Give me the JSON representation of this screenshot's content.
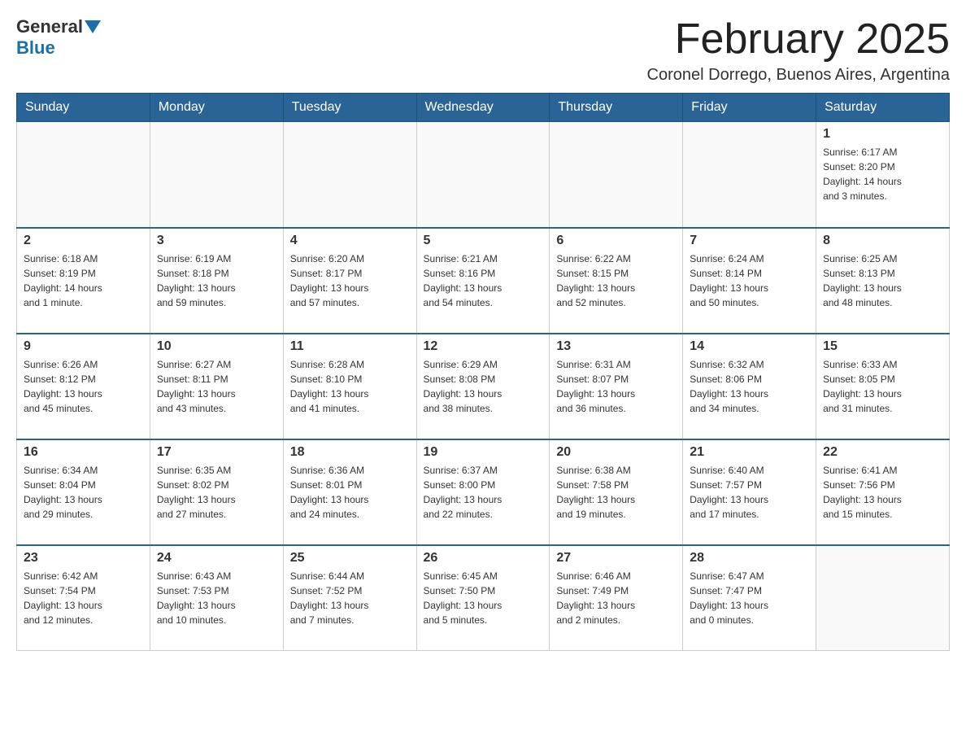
{
  "logo": {
    "general": "General",
    "blue": "Blue"
  },
  "header": {
    "month_title": "February 2025",
    "location": "Coronel Dorrego, Buenos Aires, Argentina"
  },
  "weekdays": [
    "Sunday",
    "Monday",
    "Tuesday",
    "Wednesday",
    "Thursday",
    "Friday",
    "Saturday"
  ],
  "weeks": [
    [
      {
        "day": "",
        "info": ""
      },
      {
        "day": "",
        "info": ""
      },
      {
        "day": "",
        "info": ""
      },
      {
        "day": "",
        "info": ""
      },
      {
        "day": "",
        "info": ""
      },
      {
        "day": "",
        "info": ""
      },
      {
        "day": "1",
        "info": "Sunrise: 6:17 AM\nSunset: 8:20 PM\nDaylight: 14 hours\nand 3 minutes."
      }
    ],
    [
      {
        "day": "2",
        "info": "Sunrise: 6:18 AM\nSunset: 8:19 PM\nDaylight: 14 hours\nand 1 minute."
      },
      {
        "day": "3",
        "info": "Sunrise: 6:19 AM\nSunset: 8:18 PM\nDaylight: 13 hours\nand 59 minutes."
      },
      {
        "day": "4",
        "info": "Sunrise: 6:20 AM\nSunset: 8:17 PM\nDaylight: 13 hours\nand 57 minutes."
      },
      {
        "day": "5",
        "info": "Sunrise: 6:21 AM\nSunset: 8:16 PM\nDaylight: 13 hours\nand 54 minutes."
      },
      {
        "day": "6",
        "info": "Sunrise: 6:22 AM\nSunset: 8:15 PM\nDaylight: 13 hours\nand 52 minutes."
      },
      {
        "day": "7",
        "info": "Sunrise: 6:24 AM\nSunset: 8:14 PM\nDaylight: 13 hours\nand 50 minutes."
      },
      {
        "day": "8",
        "info": "Sunrise: 6:25 AM\nSunset: 8:13 PM\nDaylight: 13 hours\nand 48 minutes."
      }
    ],
    [
      {
        "day": "9",
        "info": "Sunrise: 6:26 AM\nSunset: 8:12 PM\nDaylight: 13 hours\nand 45 minutes."
      },
      {
        "day": "10",
        "info": "Sunrise: 6:27 AM\nSunset: 8:11 PM\nDaylight: 13 hours\nand 43 minutes."
      },
      {
        "day": "11",
        "info": "Sunrise: 6:28 AM\nSunset: 8:10 PM\nDaylight: 13 hours\nand 41 minutes."
      },
      {
        "day": "12",
        "info": "Sunrise: 6:29 AM\nSunset: 8:08 PM\nDaylight: 13 hours\nand 38 minutes."
      },
      {
        "day": "13",
        "info": "Sunrise: 6:31 AM\nSunset: 8:07 PM\nDaylight: 13 hours\nand 36 minutes."
      },
      {
        "day": "14",
        "info": "Sunrise: 6:32 AM\nSunset: 8:06 PM\nDaylight: 13 hours\nand 34 minutes."
      },
      {
        "day": "15",
        "info": "Sunrise: 6:33 AM\nSunset: 8:05 PM\nDaylight: 13 hours\nand 31 minutes."
      }
    ],
    [
      {
        "day": "16",
        "info": "Sunrise: 6:34 AM\nSunset: 8:04 PM\nDaylight: 13 hours\nand 29 minutes."
      },
      {
        "day": "17",
        "info": "Sunrise: 6:35 AM\nSunset: 8:02 PM\nDaylight: 13 hours\nand 27 minutes."
      },
      {
        "day": "18",
        "info": "Sunrise: 6:36 AM\nSunset: 8:01 PM\nDaylight: 13 hours\nand 24 minutes."
      },
      {
        "day": "19",
        "info": "Sunrise: 6:37 AM\nSunset: 8:00 PM\nDaylight: 13 hours\nand 22 minutes."
      },
      {
        "day": "20",
        "info": "Sunrise: 6:38 AM\nSunset: 7:58 PM\nDaylight: 13 hours\nand 19 minutes."
      },
      {
        "day": "21",
        "info": "Sunrise: 6:40 AM\nSunset: 7:57 PM\nDaylight: 13 hours\nand 17 minutes."
      },
      {
        "day": "22",
        "info": "Sunrise: 6:41 AM\nSunset: 7:56 PM\nDaylight: 13 hours\nand 15 minutes."
      }
    ],
    [
      {
        "day": "23",
        "info": "Sunrise: 6:42 AM\nSunset: 7:54 PM\nDaylight: 13 hours\nand 12 minutes."
      },
      {
        "day": "24",
        "info": "Sunrise: 6:43 AM\nSunset: 7:53 PM\nDaylight: 13 hours\nand 10 minutes."
      },
      {
        "day": "25",
        "info": "Sunrise: 6:44 AM\nSunset: 7:52 PM\nDaylight: 13 hours\nand 7 minutes."
      },
      {
        "day": "26",
        "info": "Sunrise: 6:45 AM\nSunset: 7:50 PM\nDaylight: 13 hours\nand 5 minutes."
      },
      {
        "day": "27",
        "info": "Sunrise: 6:46 AM\nSunset: 7:49 PM\nDaylight: 13 hours\nand 2 minutes."
      },
      {
        "day": "28",
        "info": "Sunrise: 6:47 AM\nSunset: 7:47 PM\nDaylight: 13 hours\nand 0 minutes."
      },
      {
        "day": "",
        "info": ""
      }
    ]
  ]
}
